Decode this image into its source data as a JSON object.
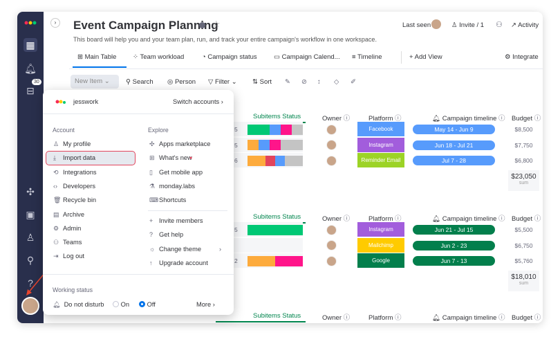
{
  "board": {
    "title": "Event Campaign Planning",
    "description": "This board will help you and your team plan, run, and track your entire campaign's workflow in one workspace.",
    "last_seen": "Last seen",
    "invite": "Invite / 1",
    "activity": "Activity"
  },
  "sidebar": {
    "inbox_badge": "30"
  },
  "tabs": [
    {
      "label": "Main Table",
      "active": true
    },
    {
      "label": "Team workload"
    },
    {
      "label": "Campaign status"
    },
    {
      "label": "Campaign Calend..."
    },
    {
      "label": "Timeline"
    },
    {
      "label": "+ Add View"
    }
  ],
  "integrate": "Integrate",
  "toolbar": {
    "new_item": "New Item",
    "search": "Search",
    "person": "Person",
    "filter": "Filter",
    "sort": "Sort"
  },
  "columns": {
    "subitems": "Subitems Status",
    "owner": "Owner",
    "platform": "Platform",
    "timeline": "Campaign timeline",
    "budget": "Budget"
  },
  "groups": [
    {
      "rows": [
        {
          "num": "5",
          "bar": [
            [
              "#00c875",
              40
            ],
            [
              "#579bfc",
              20
            ],
            [
              "#ff158a",
              20
            ],
            [
              "#c4c4c4",
              20
            ]
          ],
          "platform": "Facebook",
          "platform_color": "#579bfc",
          "timeline": "May 14 - Jun 9",
          "timeline_color": "#579bfc",
          "budget": "$8,500"
        },
        {
          "num": "5",
          "bar": [
            [
              "#fdab3d",
              20
            ],
            [
              "#579bfc",
              20
            ],
            [
              "#ff158a",
              20
            ],
            [
              "#c4c4c4",
              40
            ]
          ],
          "platform": "Instagram",
          "platform_color": "#a25ddc",
          "timeline": "Jun 18 - Jul 21",
          "timeline_color": "#579bfc",
          "budget": "$7,750"
        },
        {
          "num": "6",
          "bar": [
            [
              "#fdab3d",
              33
            ],
            [
              "#e2445c",
              17
            ],
            [
              "#579bfc",
              17
            ],
            [
              "#c4c4c4",
              33
            ]
          ],
          "platform": "Reminder Email",
          "platform_color": "#9cd326",
          "timeline": "Jul 7 - 28",
          "timeline_color": "#579bfc",
          "budget": "$6,800"
        }
      ],
      "sum": "$23,050",
      "sum_label": "sum"
    },
    {
      "rows": [
        {
          "num": "5",
          "bar": [
            [
              "#00c875",
              100
            ]
          ],
          "platform": "Instagram",
          "platform_color": "#a25ddc",
          "timeline": "Jun 21 - Jul 15",
          "timeline_color": "#037f4c",
          "budget": "$5,500"
        },
        {
          "num": "",
          "bar": [],
          "platform": "Mailchimp",
          "platform_color": "#ffcb00",
          "timeline": "Jun 2 - 23",
          "timeline_color": "#037f4c",
          "budget": "$6,750"
        },
        {
          "num": "2",
          "bar": [
            [
              "#fdab3d",
              50
            ],
            [
              "#ff158a",
              50
            ]
          ],
          "platform": "Google",
          "platform_color": "#037f4c",
          "timeline": "Jun 7 - 13",
          "timeline_color": "#037f4c",
          "budget": "$5,760"
        }
      ],
      "sum": "$18,010",
      "sum_label": "sum"
    },
    {
      "rows": []
    }
  ],
  "menu": {
    "account_name": "jesswork",
    "switch_accounts": "Switch accounts",
    "account_title": "Account",
    "explore_title": "Explore",
    "account_items": [
      {
        "label": "My profile",
        "icon": "person-icon"
      },
      {
        "label": "Import data",
        "icon": "download-icon",
        "highlighted": true
      },
      {
        "label": "Integrations",
        "icon": "integrations-icon"
      },
      {
        "label": "Developers",
        "icon": "code-icon"
      },
      {
        "label": "Recycle bin",
        "icon": "trash-icon"
      },
      {
        "label": "Archive",
        "icon": "archive-icon"
      },
      {
        "label": "Admin",
        "icon": "gear-icon"
      },
      {
        "label": "Teams",
        "icon": "teams-icon"
      },
      {
        "label": "Log out",
        "icon": "logout-icon"
      }
    ],
    "explore_items": [
      {
        "label": "Apps marketplace",
        "icon": "puzzle-icon"
      },
      {
        "label": "What's new",
        "icon": "gift-icon"
      },
      {
        "label": "Get mobile app",
        "icon": "mobile-icon"
      },
      {
        "label": "monday.labs",
        "icon": "flask-icon"
      },
      {
        "label": "Shortcuts",
        "icon": "keyboard-icon"
      }
    ],
    "more_items": [
      {
        "label": "Invite members",
        "icon": "plus-icon"
      },
      {
        "label": "Get help",
        "icon": "question-icon"
      },
      {
        "label": "Change theme",
        "icon": "sun-icon"
      },
      {
        "label": "Upgrade account",
        "icon": "arrow-up-icon"
      }
    ],
    "working_status": "Working status",
    "dnd": "Do not disturb",
    "on": "On",
    "off": "Off",
    "dnd_value": "Off",
    "more": "More"
  },
  "colors": {
    "accent": "#0073ea",
    "highlight_border": "#e2445c",
    "sidebar": "#292f4c"
  }
}
